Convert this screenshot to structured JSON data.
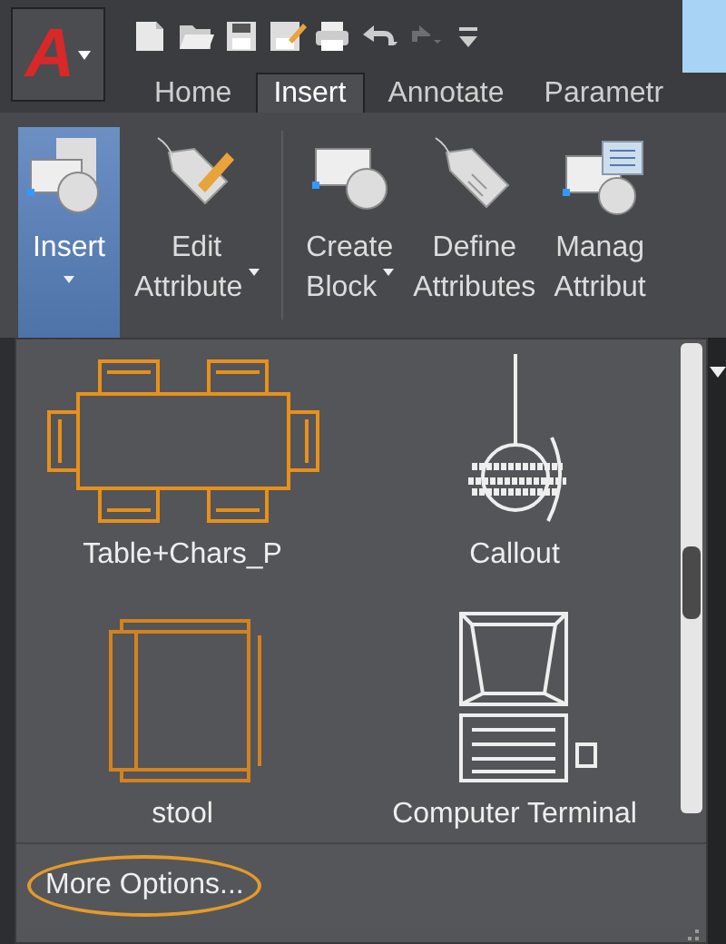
{
  "app_menu": {
    "label": "A"
  },
  "quick_access": [
    {
      "kind": "new",
      "disabled": false
    },
    {
      "kind": "open",
      "disabled": false
    },
    {
      "kind": "save",
      "disabled": false
    },
    {
      "kind": "saveas",
      "disabled": false
    },
    {
      "kind": "print",
      "disabled": false
    },
    {
      "kind": "undo",
      "disabled": false
    },
    {
      "kind": "redo",
      "disabled": true
    },
    {
      "kind": "customize",
      "disabled": false
    }
  ],
  "tabs": [
    {
      "label": "Home",
      "selected": false
    },
    {
      "label": "Insert",
      "selected": true
    },
    {
      "label": "Annotate",
      "selected": false
    },
    {
      "label": "Parametr",
      "selected": false
    }
  ],
  "ribbon": [
    {
      "kind": "insert",
      "lines": [
        "Insert"
      ],
      "selected": true,
      "dropdown": true
    },
    {
      "kind": "edit-attribute",
      "lines": [
        "Edit",
        "Attribute"
      ],
      "selected": false,
      "dropdown": true
    },
    {
      "kind": "create-block",
      "lines": [
        "Create",
        "Block"
      ],
      "selected": false,
      "dropdown": true
    },
    {
      "kind": "define-attributes",
      "lines": [
        "Define",
        "Attributes"
      ],
      "selected": false,
      "dropdown": false
    },
    {
      "kind": "manage-attributes",
      "lines": [
        "Manag",
        "Attribut"
      ],
      "selected": false,
      "dropdown": false
    }
  ],
  "gallery": [
    {
      "kind": "table",
      "name": "Table+Chars_P"
    },
    {
      "kind": "callout",
      "name": "Callout"
    },
    {
      "kind": "chair",
      "name": "stool"
    },
    {
      "kind": "terminal",
      "name": "Computer Terminal"
    }
  ],
  "footer": {
    "label": "More Options..."
  }
}
